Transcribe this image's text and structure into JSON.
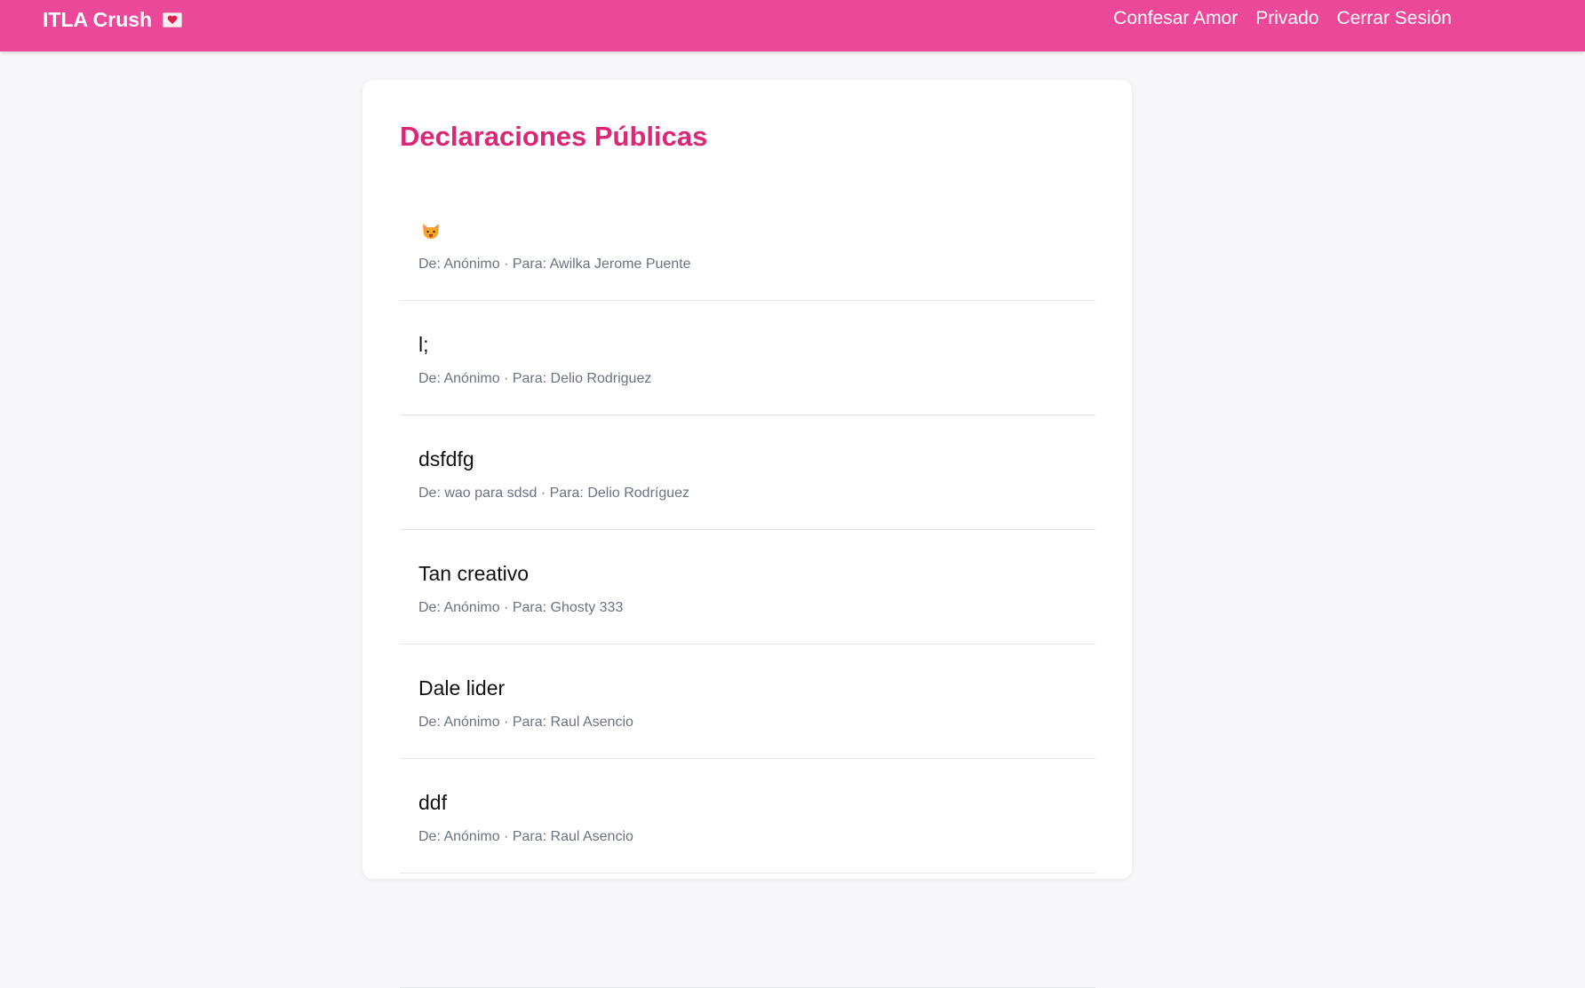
{
  "app": {
    "brand": "ITLA Crush",
    "brand_icon": "love-letter-icon",
    "accent_color": "#ec4899",
    "title_color": "#db2777"
  },
  "nav": {
    "links": [
      "Confesar Amor",
      "Privado",
      "Cerrar Sesión"
    ]
  },
  "main": {
    "title": "Declaraciones Públicas",
    "declarations": [
      {
        "message": "",
        "icon": "cat-face-icon",
        "meta": "De: Anónimo · Para: Awilka Jerome Puente"
      },
      {
        "message": "l;",
        "meta": "De: Anónimo · Para: Delio Rodriguez"
      },
      {
        "message": "dsfdfg",
        "meta": "De: wao para sdsd · Para: Delio Rodríguez"
      },
      {
        "message": "Tan creativo",
        "meta": "De: Anónimo · Para: Ghosty 333"
      },
      {
        "message": "Dale lider",
        "meta": "De: Anónimo · Para: Raul Asencio"
      },
      {
        "message": "ddf",
        "meta": "De: Anónimo · Para: Raul Asencio"
      },
      {
        "message": "",
        "meta": ""
      }
    ]
  }
}
